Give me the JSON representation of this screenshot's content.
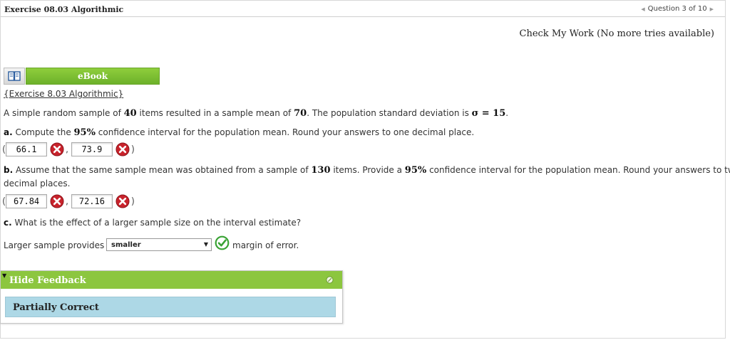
{
  "header": {
    "exercise_title": "Exercise 08.03 Algorithmic",
    "question_nav": "Question 3 of 10"
  },
  "check_my_work": "Check My Work (No more tries available)",
  "ebook": {
    "label": "eBook",
    "icon": "book-icon"
  },
  "exercise_link": "{Exercise 8.03 Algorithmic}",
  "problem": {
    "intro_1": "A simple random sample of ",
    "n": "40",
    "intro_2": " items resulted in a sample mean of ",
    "mean": "70",
    "intro_3": ". The population standard deviation is ",
    "sigma": "σ = 15",
    "intro_4": ".",
    "a_label": "a.",
    "a_text_1": " Compute the ",
    "a_pct": "95%",
    "a_text_2": " confidence interval for the population mean. Round your answers to one decimal place.",
    "a_lower": "66.1",
    "a_upper": "73.9",
    "b_label": "b.",
    "b_text_1": " Assume that the same sample mean was obtained from a sample of ",
    "b_n": "130",
    "b_text_2": " items. Provide a ",
    "b_pct": "95%",
    "b_text_3": " confidence interval for the population mean. Round your answers to two",
    "b_text_4": "decimal places.",
    "b_lower": "67.84",
    "b_upper": "72.16",
    "c_label": "c.",
    "c_text": " What is the effect of a larger sample size on the interval estimate?",
    "c_prefix": "Larger sample provides a",
    "c_selected": "smaller",
    "c_suffix": "margin of error."
  },
  "punct": {
    "open": "(",
    "close": ")",
    "comma": ","
  },
  "feedback": {
    "toggle": "Hide Feedback",
    "status": "Partially Correct"
  },
  "colors": {
    "green": "#8cc63f",
    "incorrect_red": "#c8232c",
    "correct_green": "#3aa335",
    "feedback_blue": "#add8e6"
  }
}
